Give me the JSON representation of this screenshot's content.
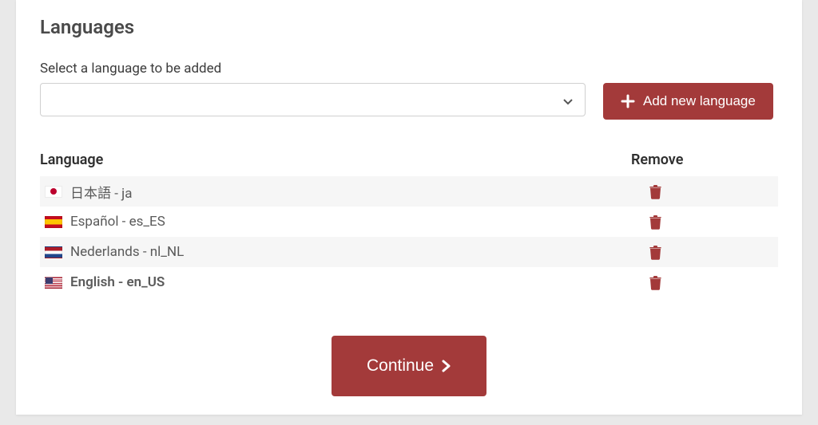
{
  "title": "Languages",
  "select": {
    "label": "Select a language to be added",
    "value": ""
  },
  "add_button": {
    "label": "Add new language"
  },
  "table": {
    "headers": {
      "language": "Language",
      "remove": "Remove"
    },
    "rows": [
      {
        "flag": "ja",
        "label": "日本語 - ja",
        "bold": false
      },
      {
        "flag": "es",
        "label": "Español - es_ES",
        "bold": false
      },
      {
        "flag": "nl",
        "label": "Nederlands - nl_NL",
        "bold": false
      },
      {
        "flag": "us",
        "label": "English - en_US",
        "bold": true
      }
    ]
  },
  "continue_button": {
    "label": "Continue"
  },
  "colors": {
    "accent": "#a33a3a"
  }
}
